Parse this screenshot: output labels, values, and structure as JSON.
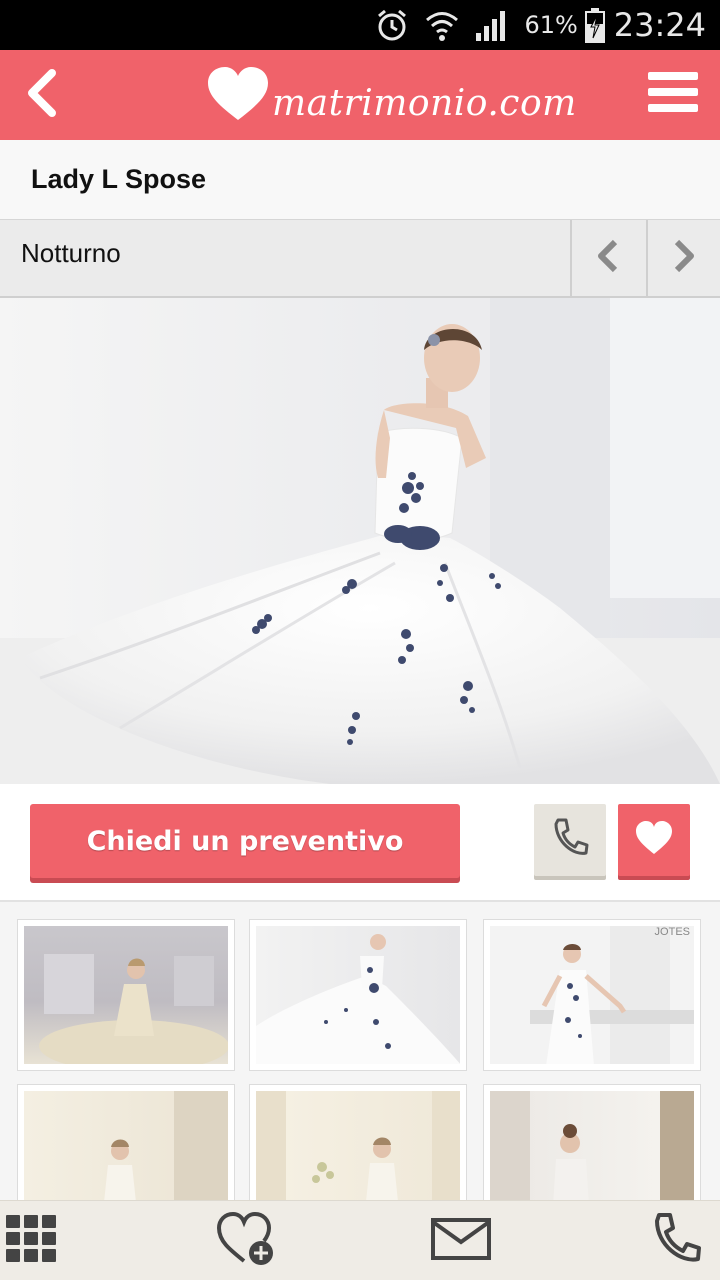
{
  "status_bar": {
    "battery_percent": "61%",
    "clock": "23:24",
    "icons": [
      "alarm-icon",
      "wifi-icon",
      "signal-icon",
      "battery-charging-icon"
    ]
  },
  "header": {
    "logo_text": "matrimonio.com",
    "back_icon": "chevron-left-icon",
    "menu_icon": "hamburger-menu-icon",
    "brand_color": "#f0626a"
  },
  "vendor": {
    "name": "Lady L Spose"
  },
  "dress": {
    "name": "Notturno",
    "prev_icon": "chevron-left-icon",
    "next_icon": "chevron-right-icon"
  },
  "actions": {
    "quote_label": "Chiedi un preventivo",
    "phone_icon": "phone-icon",
    "favorite_icon": "heart-icon"
  },
  "gallery": {
    "thumb_watermark": "JOTES"
  },
  "bottom_nav": {
    "items": [
      "grid-icon",
      "heart-plus-icon",
      "mail-icon",
      "phone-icon"
    ]
  }
}
